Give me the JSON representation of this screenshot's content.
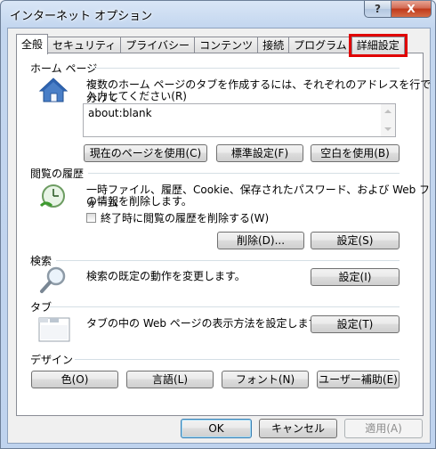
{
  "window": {
    "title": "インターネット オプション",
    "help_label": "?",
    "close_label": "X"
  },
  "tabs": [
    {
      "label": "全般",
      "active": true
    },
    {
      "label": "セキュリティ"
    },
    {
      "label": "プライバシー"
    },
    {
      "label": "コンテンツ"
    },
    {
      "label": "接続"
    },
    {
      "label": "プログラム"
    },
    {
      "label": "詳細設定",
      "highlighted": true
    }
  ],
  "home": {
    "title": "ホーム ページ",
    "desc_line1": "複数のホーム ページのタブを作成するには、それぞれのアドレスを行で分けて",
    "desc_line2": "入力してください(R)",
    "value": "about:blank",
    "btn_current": "現在のページを使用(C)",
    "btn_default": "標準設定(F)",
    "btn_blank": "空白を使用(B)"
  },
  "history": {
    "title": "閲覧の履歴",
    "desc_line1": "一時ファイル、履歴、Cookie、保存されたパスワード、および Web フォーム",
    "desc_line2": "の情報を削除します。",
    "checkbox_label": "終了時に閲覧の履歴を削除する(W)",
    "btn_delete": "削除(D)...",
    "btn_settings": "設定(S)"
  },
  "search": {
    "title": "検索",
    "desc": "検索の既定の動作を変更します。",
    "btn_settings": "設定(I)"
  },
  "tabs_section": {
    "title": "タブ",
    "desc": "タブの中の Web ページの表示方法を設定します。",
    "btn_settings": "設定(T)"
  },
  "design": {
    "title": "デザイン",
    "btn_color": "色(O)",
    "btn_language": "言語(L)",
    "btn_font": "フォント(N)",
    "btn_accessibility": "ユーザー補助(E)"
  },
  "footer": {
    "ok": "OK",
    "cancel": "キャンセル",
    "apply": "適用(A)"
  }
}
